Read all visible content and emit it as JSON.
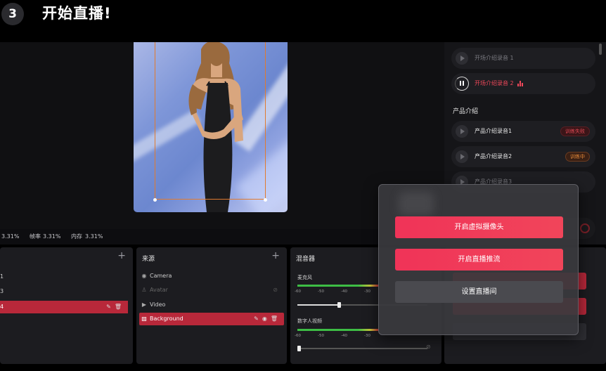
{
  "header": {
    "step": "3",
    "title": "开始直播!"
  },
  "status_bar": {
    "cpu": "3.31%",
    "fps_label": "帧率",
    "fps": "3.31%",
    "mem_label": "内存",
    "mem": "3.31%"
  },
  "intro_audio": {
    "items": [
      {
        "label": "开场介绍录音 1",
        "state": "idle"
      },
      {
        "label": "开场介绍录音 2",
        "state": "playing"
      }
    ]
  },
  "product_section": {
    "title": "产品介绍",
    "items": [
      {
        "label": "产品介绍录音1",
        "tag": "训练失败"
      },
      {
        "label": "产品介绍录音2",
        "tag": "训练中"
      },
      {
        "label": "产品介绍录音3",
        "tag": ""
      }
    ]
  },
  "scenes": {
    "items": [
      {
        "label": "1"
      },
      {
        "label": "3"
      },
      {
        "label": "4",
        "active": true
      }
    ],
    "add": "+"
  },
  "sources": {
    "title": "来源",
    "add": "+",
    "items": [
      {
        "label": "Camera",
        "icon": "camera-icon"
      },
      {
        "label": "Avatar",
        "icon": "user-icon",
        "disabled": true
      },
      {
        "label": "Video",
        "icon": "video-icon"
      },
      {
        "label": "Background",
        "icon": "background-icon",
        "active": true
      }
    ]
  },
  "mixer": {
    "title": "混音器",
    "channels": [
      {
        "label": "麦克风",
        "level": 0.32
      },
      {
        "label": "数字人视频",
        "level": 0.0
      }
    ],
    "ticks": [
      "-60",
      "-50",
      "-40",
      "-30"
    ]
  },
  "modal": {
    "buttons": [
      {
        "label": "开启虚拟摄像头"
      },
      {
        "label": "开启直播推流"
      },
      {
        "label": "设置直播间"
      }
    ]
  },
  "colors": {
    "accent": "#f03358",
    "danger": "#b8283a",
    "selection": "#e07a2f"
  }
}
